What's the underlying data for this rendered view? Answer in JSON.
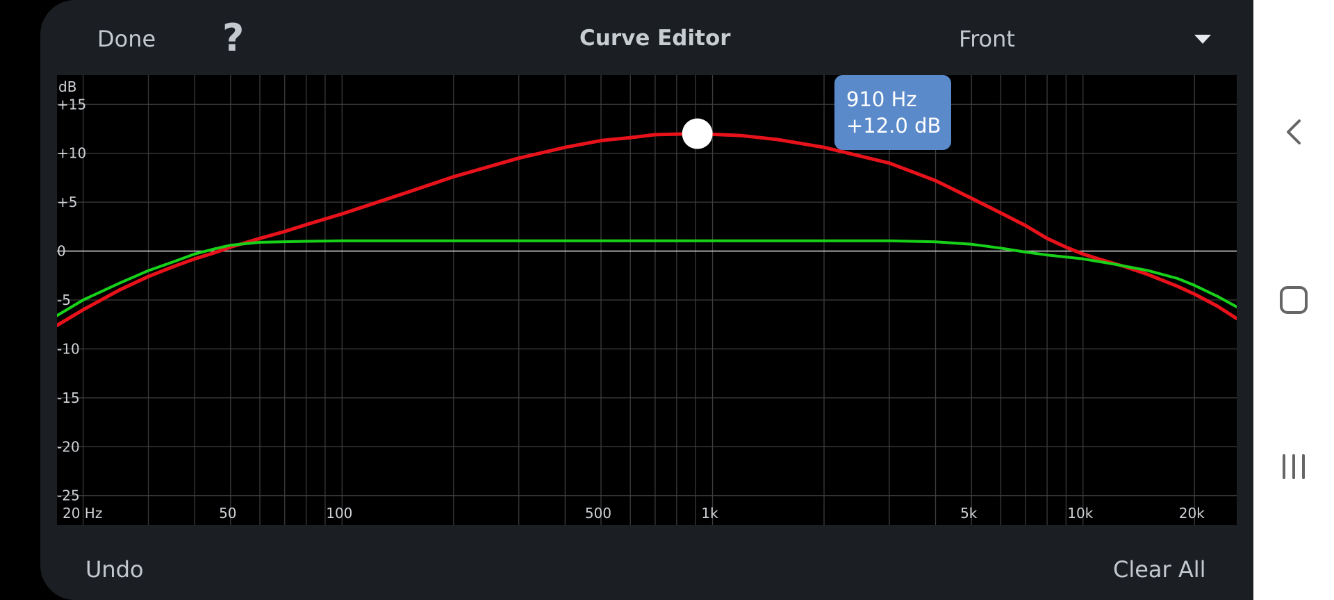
{
  "toolbar": {
    "done_label": "Done",
    "help_label": "?",
    "title": "Curve Editor",
    "channel_value": "Front"
  },
  "bottom": {
    "undo_label": "Undo",
    "clear_label": "Clear All"
  },
  "tooltip": {
    "freq": "910 Hz",
    "gain": "+12.0 dB"
  },
  "chart_data": {
    "type": "line",
    "xscale": "log",
    "xlim": [
      17,
      26000
    ],
    "ylim": [
      -28,
      18
    ],
    "ylabel": "dB",
    "y_ticks": [
      {
        "v": 15,
        "label": "+15"
      },
      {
        "v": 10,
        "label": "+10"
      },
      {
        "v": 5,
        "label": "+5"
      },
      {
        "v": 0,
        "label": "0"
      },
      {
        "v": -5,
        "label": "-5"
      },
      {
        "v": -10,
        "label": "-10"
      },
      {
        "v": -15,
        "label": "-15"
      },
      {
        "v": -20,
        "label": "-20"
      },
      {
        "v": -25,
        "label": "-25"
      }
    ],
    "x_ticks": [
      {
        "v": 20,
        "label": "20 Hz"
      },
      {
        "v": 50,
        "label": "50"
      },
      {
        "v": 100,
        "label": "100"
      },
      {
        "v": 500,
        "label": "500"
      },
      {
        "v": 1000,
        "label": "1k"
      },
      {
        "v": 5000,
        "label": "5k"
      },
      {
        "v": 10000,
        "label": "10k"
      },
      {
        "v": 20000,
        "label": "20k"
      }
    ],
    "grid_x": [
      20,
      30,
      40,
      50,
      60,
      70,
      80,
      90,
      100,
      200,
      300,
      400,
      500,
      600,
      700,
      800,
      900,
      1000,
      2000,
      3000,
      4000,
      5000,
      6000,
      7000,
      8000,
      9000,
      10000,
      20000
    ],
    "grid_y": [
      15,
      10,
      5,
      -5,
      -10,
      -15,
      -20,
      -25
    ],
    "control_point": {
      "x": 910,
      "y": 12.0
    },
    "series": [
      {
        "color": "#e8121b",
        "points": [
          [
            17,
            -7.6
          ],
          [
            20,
            -6
          ],
          [
            25,
            -4
          ],
          [
            30,
            -2.6
          ],
          [
            35,
            -1.6
          ],
          [
            40,
            -0.8
          ],
          [
            45,
            -0.2
          ],
          [
            50,
            0.4
          ],
          [
            60,
            1.3
          ],
          [
            70,
            2
          ],
          [
            80,
            2.7
          ],
          [
            100,
            3.8
          ],
          [
            150,
            6
          ],
          [
            200,
            7.6
          ],
          [
            300,
            9.5
          ],
          [
            400,
            10.6
          ],
          [
            500,
            11.3
          ],
          [
            600,
            11.6
          ],
          [
            700,
            11.9
          ],
          [
            910,
            12
          ],
          [
            1200,
            11.8
          ],
          [
            1500,
            11.4
          ],
          [
            2000,
            10.6
          ],
          [
            3000,
            9
          ],
          [
            4000,
            7.2
          ],
          [
            5000,
            5.4
          ],
          [
            6000,
            3.9
          ],
          [
            7000,
            2.6
          ],
          [
            8000,
            1.3
          ],
          [
            9000,
            0.4
          ],
          [
            10000,
            -0.3
          ],
          [
            11000,
            -0.8
          ],
          [
            13000,
            -1.6
          ],
          [
            15000,
            -2.4
          ],
          [
            18000,
            -3.6
          ],
          [
            20000,
            -4.4
          ],
          [
            23000,
            -5.6
          ],
          [
            26000,
            -6.9
          ]
        ]
      },
      {
        "color": "#18d21a",
        "points": [
          [
            17,
            -6.6
          ],
          [
            20,
            -5
          ],
          [
            25,
            -3.3
          ],
          [
            30,
            -2
          ],
          [
            35,
            -1.1
          ],
          [
            40,
            -0.3
          ],
          [
            45,
            0.2
          ],
          [
            50,
            0.6
          ],
          [
            60,
            0.9
          ],
          [
            80,
            1.0
          ],
          [
            100,
            1.05
          ],
          [
            200,
            1.05
          ],
          [
            500,
            1.05
          ],
          [
            1000,
            1.05
          ],
          [
            2000,
            1.05
          ],
          [
            3000,
            1.05
          ],
          [
            4000,
            0.95
          ],
          [
            5000,
            0.7
          ],
          [
            6000,
            0.3
          ],
          [
            7000,
            -0.1
          ],
          [
            8000,
            -0.4
          ],
          [
            10000,
            -0.8
          ],
          [
            12000,
            -1.3
          ],
          [
            15000,
            -2.0
          ],
          [
            18000,
            -2.8
          ],
          [
            20000,
            -3.5
          ],
          [
            23000,
            -4.6
          ],
          [
            26000,
            -5.7
          ]
        ]
      }
    ]
  },
  "colors": {
    "panel": "#1b1e22",
    "tooltip": "#5b8acb",
    "grid": "#3c3c3c",
    "zero_line": "#d0d0d0"
  },
  "nav": {
    "back_icon": "back-chevron-icon",
    "home_icon": "home-square-icon",
    "recents_icon": "recents-lines-icon"
  }
}
